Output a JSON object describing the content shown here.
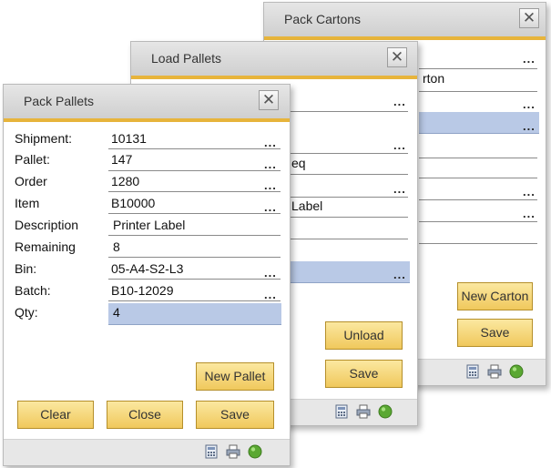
{
  "windows": {
    "pack_cartons": {
      "title": "Pack Cartons",
      "close": "✕",
      "visible_values": [
        "rton",
        "",
        "",
        "",
        "",
        "",
        ""
      ],
      "new_button": "New Carton",
      "save_button": "Save",
      "dots": "..."
    },
    "load_pallets": {
      "title": "Load Pallets",
      "close": "✕",
      "visible_values": [
        "eq",
        "Label"
      ],
      "unload_button": "Unload",
      "save_button": "Save",
      "dots": "..."
    },
    "pack_pallets": {
      "title": "Pack Pallets",
      "close": "✕",
      "dots": "...",
      "fields": [
        {
          "label": "Shipment:",
          "value": "10131"
        },
        {
          "label": "Pallet:",
          "value": "147"
        },
        {
          "label": "Order",
          "value": "1280"
        },
        {
          "label": "Item",
          "value": "B10000"
        },
        {
          "label": "Description",
          "value": "Printer Label"
        },
        {
          "label": "Remaining",
          "value": "8"
        },
        {
          "label": "Bin:",
          "value": "05-A4-S2-L3"
        },
        {
          "label": "Batch:",
          "value": "B10-12029"
        },
        {
          "label": "Qty:",
          "value": "4"
        }
      ],
      "new_pallet_button": "New Pallet",
      "clear_button": "Clear",
      "close_button": "Close",
      "save_button": "Save"
    }
  },
  "footer_icons": [
    "calculator-icon",
    "printer-icon",
    "status-green-icon"
  ],
  "colors": {
    "accent_bar": "#e7b43b",
    "button_fill": "#f0c85c",
    "highlight": "#b9c9e6"
  }
}
